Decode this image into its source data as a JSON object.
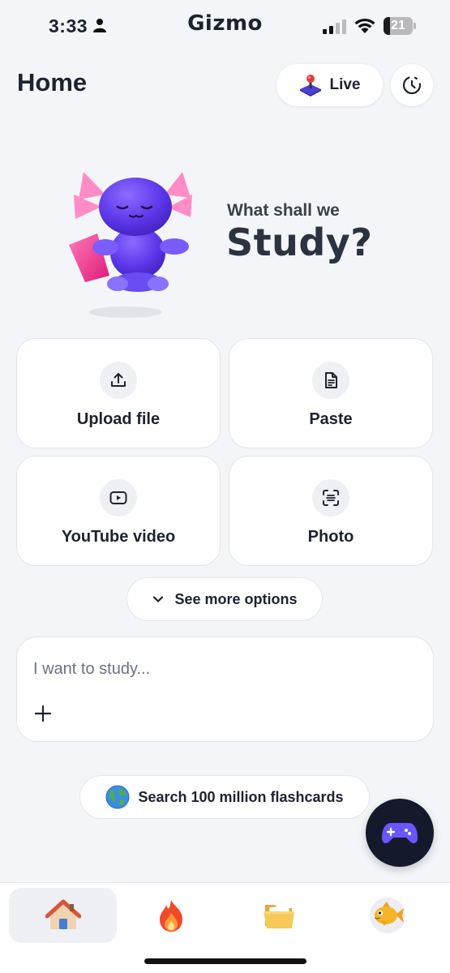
{
  "status_bar": {
    "time": "3:33",
    "brand": "Gizmo",
    "battery": "21"
  },
  "header": {
    "title": "Home",
    "live_label": "Live"
  },
  "hero": {
    "line1": "What shall we",
    "line2": "Study?"
  },
  "options": [
    {
      "label": "Upload file",
      "icon": "upload-icon"
    },
    {
      "label": "Paste",
      "icon": "document-icon"
    },
    {
      "label": "YouTube video",
      "icon": "play-icon"
    },
    {
      "label": "Photo",
      "icon": "scan-icon"
    }
  ],
  "more_options": {
    "label": "See more options"
  },
  "study_input": {
    "placeholder": "I want to study..."
  },
  "flashcards": {
    "label": "Search 100 million flashcards"
  },
  "nav": [
    {
      "name": "home",
      "icon": "house-icon"
    },
    {
      "name": "streak",
      "icon": "fire-icon"
    },
    {
      "name": "library",
      "icon": "folder-icon"
    },
    {
      "name": "profile",
      "icon": "fish-icon"
    }
  ],
  "colors": {
    "accent": "#5b3df5",
    "background": "#f4f5f9",
    "fab": "#141a2b"
  }
}
